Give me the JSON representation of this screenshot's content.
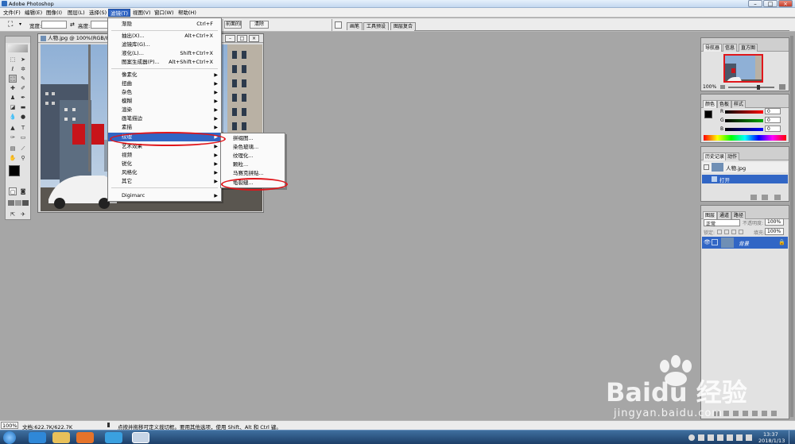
{
  "titlebar": {
    "title": "Adobe Photoshop"
  },
  "menubar": {
    "items": [
      "文件(F)",
      "编辑(E)",
      "图像(I)",
      "图层(L)",
      "选择(S)",
      "滤镜(T)",
      "视图(V)",
      "窗口(W)",
      "帮助(H)"
    ]
  },
  "options_bar": {
    "width_label": "宽度:",
    "height_label": "高度:",
    "front_image_button": "前面的图像",
    "clear_button": "清除",
    "well_tabs": [
      "画笔",
      "工具预设",
      "图层复合"
    ]
  },
  "document": {
    "title": "人物.jpg @ 100%(RGB/8)"
  },
  "filter_menu": {
    "top": [
      {
        "label": "渐隐",
        "shortcut": "Ctrl+F"
      },
      {
        "label": "抽出(X)...",
        "shortcut": "Alt+Ctrl+X"
      },
      {
        "label": "滤镜库(G)...",
        "shortcut": ""
      },
      {
        "label": "液化(L)...",
        "shortcut": "Shift+Ctrl+X"
      },
      {
        "label": "图案生成器(P)...",
        "shortcut": "Alt+Shift+Ctrl+X"
      }
    ],
    "groups": [
      "像素化",
      "扭曲",
      "杂色",
      "模糊",
      "渲染",
      "画笔描边",
      "素描",
      "纹理",
      "艺术效果",
      "视频",
      "锐化",
      "风格化",
      "其它"
    ],
    "bottom": "Digimarc",
    "active_item": "纹理"
  },
  "texture_submenu": {
    "items": [
      "拼缀图...",
      "染色玻璃...",
      "纹理化...",
      "颗粒...",
      "马赛克拼贴...",
      "龟裂缝..."
    ],
    "highlighted": "龟裂缝..."
  },
  "navigator_panel": {
    "tabs": [
      "导航器",
      "信息",
      "直方图"
    ],
    "zoom": "100%"
  },
  "color_panel": {
    "tabs": [
      "颜色",
      "色板",
      "样式"
    ],
    "channels": [
      {
        "label": "R",
        "value": "0",
        "color": "#ff0000"
      },
      {
        "label": "G",
        "value": "0",
        "color": "#00a000"
      },
      {
        "label": "B",
        "value": "0",
        "color": "#0000ff"
      }
    ]
  },
  "history_panel": {
    "tabs": [
      "历史记录",
      "动作"
    ],
    "snapshot": "人物.jpg",
    "steps": [
      "打开"
    ]
  },
  "layers_panel": {
    "tabs": [
      "图层",
      "通道",
      "路径"
    ],
    "blend_mode": "正常",
    "opacity_label": "不透明度:",
    "opacity": "100%",
    "lock_label": "锁定:",
    "fill_label": "填充:",
    "fill": "100%",
    "layer_name": "背景"
  },
  "status_bar": {
    "zoom": "100%",
    "doc_size": "文档:622.7K/622.7K",
    "hint": "点按并拖移可定义裁切框。要用其他选项，使用 Shift、Alt 和 Ctrl 键。"
  },
  "taskbar": {
    "time": "13:37",
    "date": "2018/1/13"
  },
  "watermark": {
    "brand": "Baidu 经验",
    "url": "jingyan.baidu.com"
  },
  "colors": {
    "highlight": "#3166c5",
    "annotation_ring": "#e0161b",
    "workspace": "#a6a6a6"
  }
}
